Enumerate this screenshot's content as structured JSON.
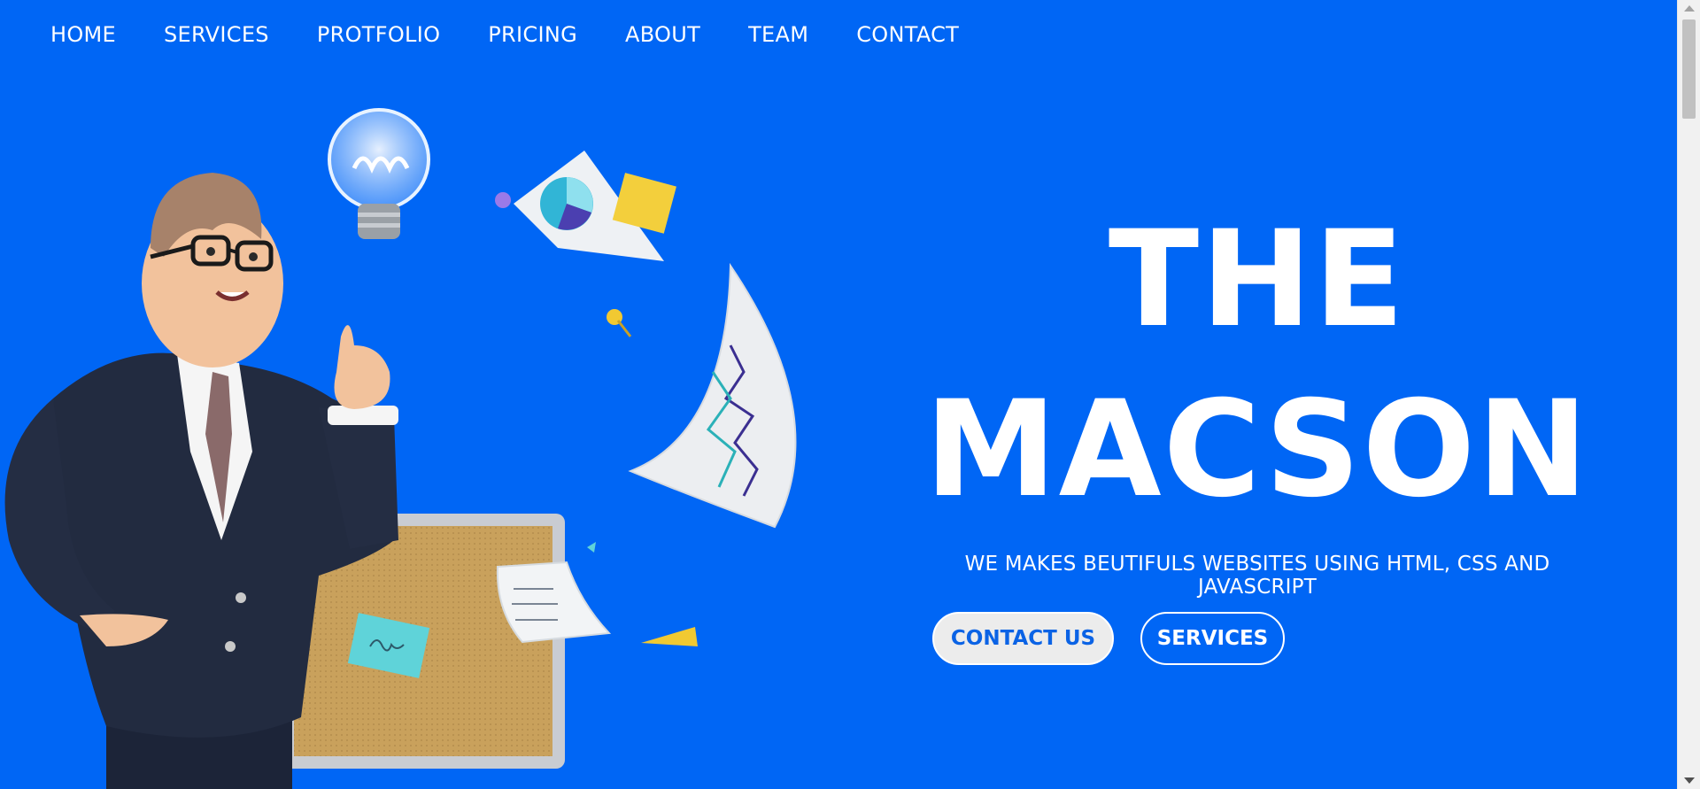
{
  "nav": {
    "items": [
      "HOME",
      "SERVICES",
      "PROTFOLIO",
      "PRICING",
      "ABOUT",
      "TEAM",
      "CONTACT"
    ]
  },
  "hero": {
    "title_line1": "THE",
    "title_line2": "MACSON",
    "subtitle": "WE MAKES BEUTIFULS WEBSITES USING HTML, CSS AND JAVASCRIPT",
    "primary_button": "CONTACT US",
    "secondary_button": "SERVICES"
  },
  "colors": {
    "background": "#0066f5",
    "text": "#ffffff",
    "button_fill": "#ececec",
    "button_text": "#0b63e5"
  },
  "icons": {
    "illustration": "businessman-idea-illustration",
    "scroll_up": "chevron-up-icon",
    "scroll_down": "chevron-down-icon"
  }
}
